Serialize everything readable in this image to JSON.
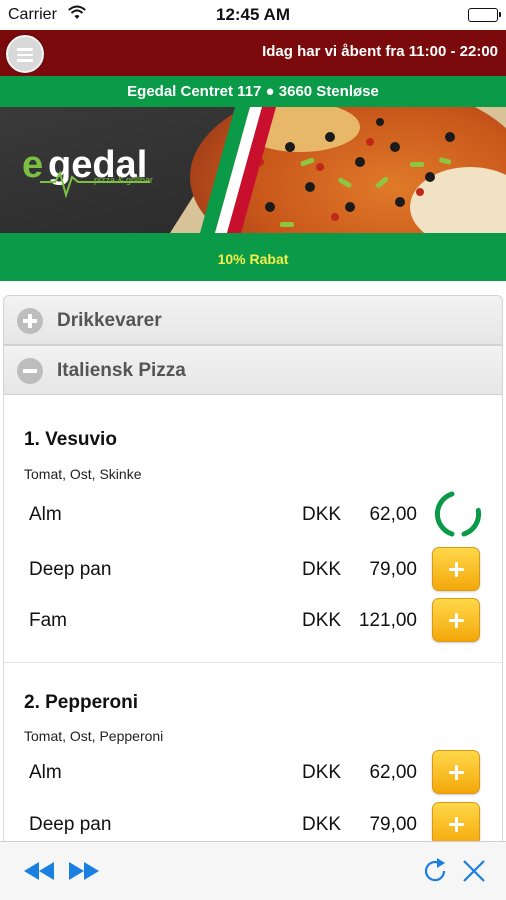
{
  "status": {
    "carrier": "Carrier",
    "time": "12:45 AM"
  },
  "header": {
    "hours": "Idag har vi åbent fra 11:00 - 22:00"
  },
  "address": "Egedal Centret 117 ● 3660 Stenløse",
  "banner": {
    "logo_text": "egedal",
    "logo_sub": "pizza & grillbar"
  },
  "rabat": "10% Rabat",
  "categories": [
    {
      "label": "Drikkevarer",
      "state": "collapsed"
    },
    {
      "label": "Italiensk Pizza",
      "state": "expanded"
    }
  ],
  "items": [
    {
      "name": "1. Vesuvio",
      "desc": "Tomat, Ost, Skinke",
      "rows": [
        {
          "label": "Alm",
          "currency": "DKK",
          "price": "62,00",
          "button": "loading-spinner"
        },
        {
          "label": "Deep pan",
          "currency": "DKK",
          "price": "79,00",
          "button": "plus"
        },
        {
          "label": "Fam",
          "currency": "DKK",
          "price": "121,00",
          "button": "plus"
        }
      ]
    },
    {
      "name": "2. Pepperoni",
      "desc": "Tomat, Ost, Pepperoni",
      "rows": [
        {
          "label": "Alm",
          "currency": "DKK",
          "price": "62,00",
          "button": "plus"
        },
        {
          "label": "Deep pan",
          "currency": "DKK",
          "price": "79,00",
          "button": "plus"
        }
      ]
    }
  ],
  "toolbar": {
    "icons": [
      "rewind-icon",
      "fast-forward-icon",
      "refresh-icon",
      "close-icon"
    ]
  },
  "colors": {
    "header_red": "#7a0a0c",
    "brand_green": "#0a9a48",
    "rabat_yellow": "#f5f04a",
    "button_orange": "#f4a80a",
    "toolbar_blue": "#1a7fe0"
  }
}
